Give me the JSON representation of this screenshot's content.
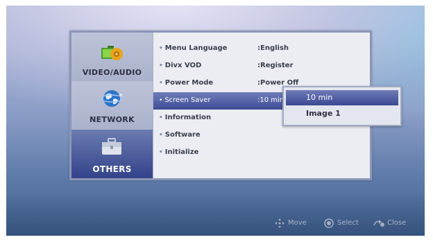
{
  "categories": [
    {
      "label": "VIDEO/AUDIO",
      "icon": "video-audio-icon"
    },
    {
      "label": "NETWORK",
      "icon": "network-globe-icon"
    },
    {
      "label": "OTHERS",
      "icon": "others-briefcase-icon"
    }
  ],
  "selected_category": "OTHERS",
  "menu": [
    {
      "label": "Menu Language",
      "value": ":English"
    },
    {
      "label": "Divx VOD",
      "value": ":Register"
    },
    {
      "label": "Power Mode",
      "value": ":Power Off"
    },
    {
      "label": "Screen Saver",
      "value": ":10 min"
    },
    {
      "label": "Information",
      "value": ""
    },
    {
      "label": "Software",
      "value": ""
    },
    {
      "label": "Initialize",
      "value": ""
    }
  ],
  "popup": {
    "options": [
      "10 min",
      "Image 1"
    ],
    "selected": "10 min"
  },
  "hints": [
    {
      "icon": "move-arrows-icon",
      "label": "Move"
    },
    {
      "icon": "select-circle-icon",
      "label": "Select"
    },
    {
      "icon": "close-back-icon",
      "label": "Close"
    }
  ],
  "colors": {
    "highlight": "#4a58a0",
    "panel_border": "#8d96b7",
    "background_top": "#aeb6d6",
    "background_bottom": "#46638f"
  }
}
